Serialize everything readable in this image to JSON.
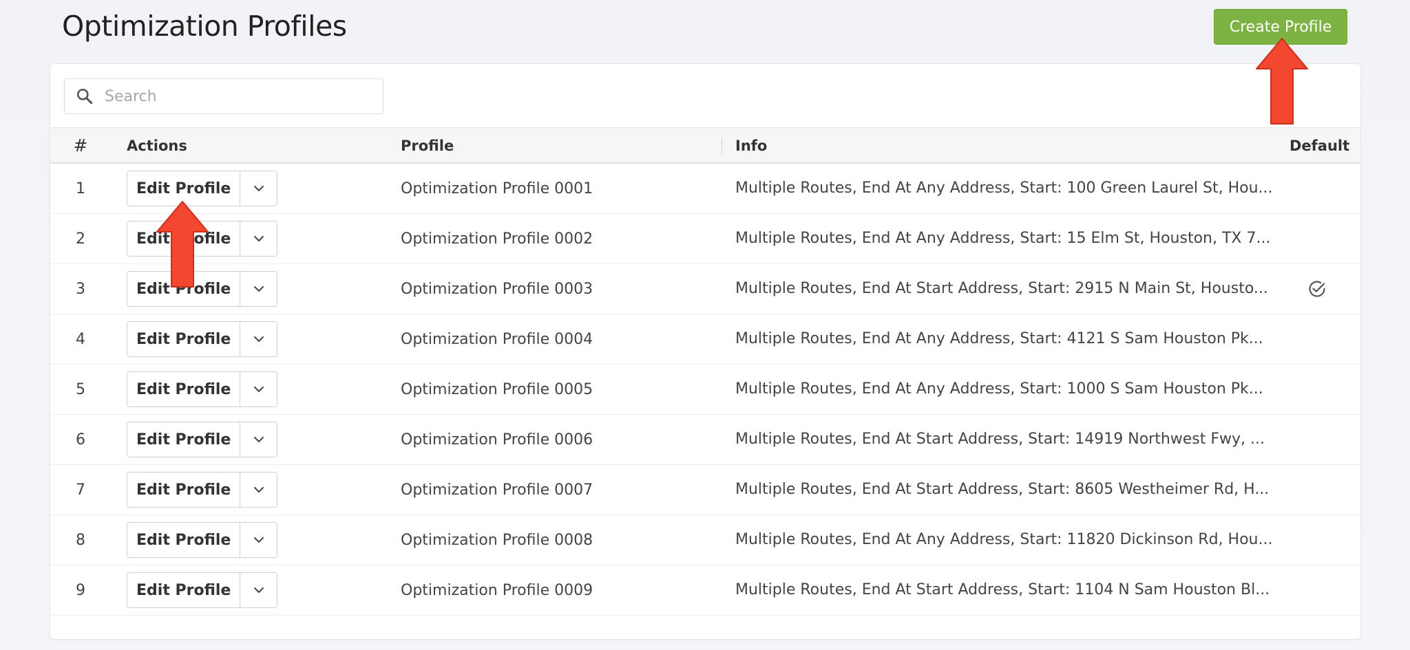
{
  "header": {
    "title": "Optimization Profiles",
    "create_label": "Create Profile",
    "accent_color": "#7cb342"
  },
  "search": {
    "placeholder": "Search",
    "value": ""
  },
  "table": {
    "columns": {
      "num": "#",
      "actions": "Actions",
      "profile": "Profile",
      "info": "Info",
      "default": "Default"
    },
    "edit_label": "Edit Profile",
    "rows": [
      {
        "num": "1",
        "profile": "Optimization Profile 0001",
        "info": "Multiple Routes, End At Any Address, Start: 100 Green Laurel St, Hou...",
        "default": false
      },
      {
        "num": "2",
        "profile": "Optimization Profile 0002",
        "info": "Multiple Routes, End At Any Address, Start: 15 Elm St, Houston, TX 7...",
        "default": false
      },
      {
        "num": "3",
        "profile": "Optimization Profile 0003",
        "info": "Multiple Routes, End At Start Address, Start: 2915 N Main St, Housto...",
        "default": true
      },
      {
        "num": "4",
        "profile": "Optimization Profile 0004",
        "info": "Multiple Routes, End At Any Address, Start: 4121 S Sam Houston Pk...",
        "default": false
      },
      {
        "num": "5",
        "profile": "Optimization Profile 0005",
        "info": "Multiple Routes, End At Any Address, Start: 1000 S Sam Houston Pk...",
        "default": false
      },
      {
        "num": "6",
        "profile": "Optimization Profile 0006",
        "info": "Multiple Routes, End At Start Address, Start: 14919 Northwest Fwy, ...",
        "default": false
      },
      {
        "num": "7",
        "profile": "Optimization Profile 0007",
        "info": "Multiple Routes, End At Start Address, Start: 8605 Westheimer Rd, H...",
        "default": false
      },
      {
        "num": "8",
        "profile": "Optimization Profile 0008",
        "info": "Multiple Routes, End At Any Address, Start: 11820 Dickinson Rd, Hou...",
        "default": false
      },
      {
        "num": "9",
        "profile": "Optimization Profile 0009",
        "info": "Multiple Routes, End At Start Address, Start: 1104 N Sam Houston Bl...",
        "default": false
      }
    ]
  },
  "icons": {
    "search": "search-icon",
    "dropdown": "chevron-down-icon",
    "default": "check-circle-icon",
    "annotation": "arrow-up-icon"
  },
  "annotation_color": "#f4472f"
}
